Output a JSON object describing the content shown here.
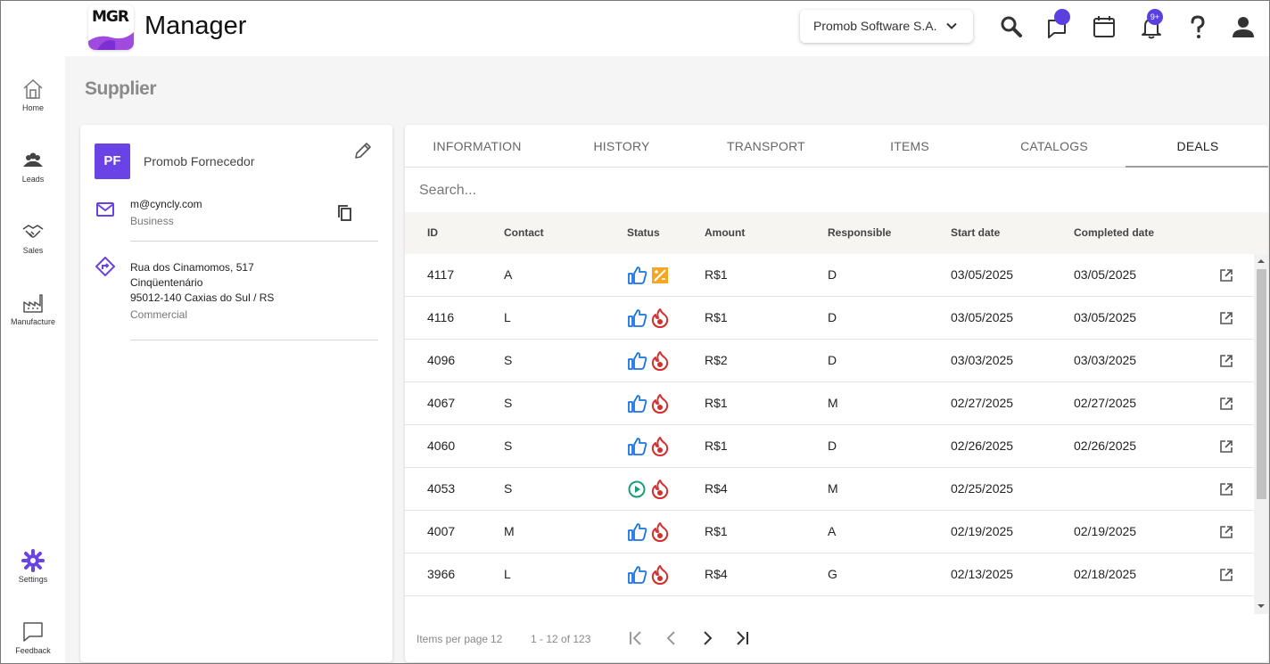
{
  "app": {
    "logo_text": "MGR",
    "title": "Manager",
    "company": "Promob Software S.A.",
    "notification_badge": "9+"
  },
  "sidebar": {
    "items": [
      {
        "label": "Home",
        "icon": "home-icon"
      },
      {
        "label": "Leads",
        "icon": "people-icon"
      },
      {
        "label": "Sales",
        "icon": "handshake-icon"
      },
      {
        "label": "Manufacture",
        "icon": "factory-icon"
      },
      {
        "label": "Settings",
        "icon": "gear-icon"
      },
      {
        "label": "Feedback",
        "icon": "feedback-icon"
      }
    ]
  },
  "page": {
    "title": "Supplier"
  },
  "supplier": {
    "initials": "PF",
    "name": "Promob Fornecedor",
    "email": "m@cyncly.com",
    "email_type": "Business",
    "address_line1": "Rua dos Cinamomos, 517",
    "address_line2": "Cinqüentenário",
    "address_line3": "95012-140 Caxias do Sul / RS",
    "address_type": "Commercial"
  },
  "tabs": [
    "INFORMATION",
    "HISTORY",
    "TRANSPORT",
    "ITEMS",
    "CATALOGS",
    "DEALS"
  ],
  "active_tab": "DEALS",
  "search": {
    "placeholder": "Search..."
  },
  "table": {
    "columns": [
      "ID",
      "Contact",
      "Status",
      "Amount",
      "Responsible",
      "Start date",
      "Completed date"
    ],
    "rows": [
      {
        "id": "4117",
        "contact": "A",
        "status": [
          "thumbs-up",
          "priority"
        ],
        "amount": "R$1",
        "responsible": "D",
        "start": "03/05/2025",
        "completed": "03/05/2025"
      },
      {
        "id": "4116",
        "contact": "L",
        "status": [
          "thumbs-up",
          "hot"
        ],
        "amount": "R$1",
        "responsible": "D",
        "start": "03/05/2025",
        "completed": "03/05/2025"
      },
      {
        "id": "4096",
        "contact": "S",
        "status": [
          "thumbs-up",
          "hot"
        ],
        "amount": "R$2",
        "responsible": "D",
        "start": "03/03/2025",
        "completed": "03/03/2025"
      },
      {
        "id": "4067",
        "contact": "S",
        "status": [
          "thumbs-up",
          "hot"
        ],
        "amount": "R$1",
        "responsible": "M",
        "start": "02/27/2025",
        "completed": "02/27/2025"
      },
      {
        "id": "4060",
        "contact": "S",
        "status": [
          "thumbs-up",
          "hot"
        ],
        "amount": "R$1",
        "responsible": "D",
        "start": "02/26/2025",
        "completed": "02/26/2025"
      },
      {
        "id": "4053",
        "contact": "S",
        "status": [
          "play",
          "hot"
        ],
        "amount": "R$4",
        "responsible": "M",
        "start": "02/25/2025",
        "completed": ""
      },
      {
        "id": "4007",
        "contact": "M",
        "status": [
          "thumbs-up",
          "hot"
        ],
        "amount": "R$1",
        "responsible": "A",
        "start": "02/19/2025",
        "completed": "02/19/2025"
      },
      {
        "id": "3966",
        "contact": "L",
        "status": [
          "thumbs-up",
          "hot"
        ],
        "amount": "R$4",
        "responsible": "G",
        "start": "02/13/2025",
        "completed": "02/18/2025"
      }
    ]
  },
  "paginator": {
    "items_per_page_label": "Items per page",
    "items_per_page": "12",
    "range": "1 - 12 of 123"
  },
  "colors": {
    "accent": "#6a43e6",
    "thumbs": "#1a73e8",
    "hot": "#d32f2f",
    "play": "#1a9e7a",
    "priority": "#f5a623"
  }
}
